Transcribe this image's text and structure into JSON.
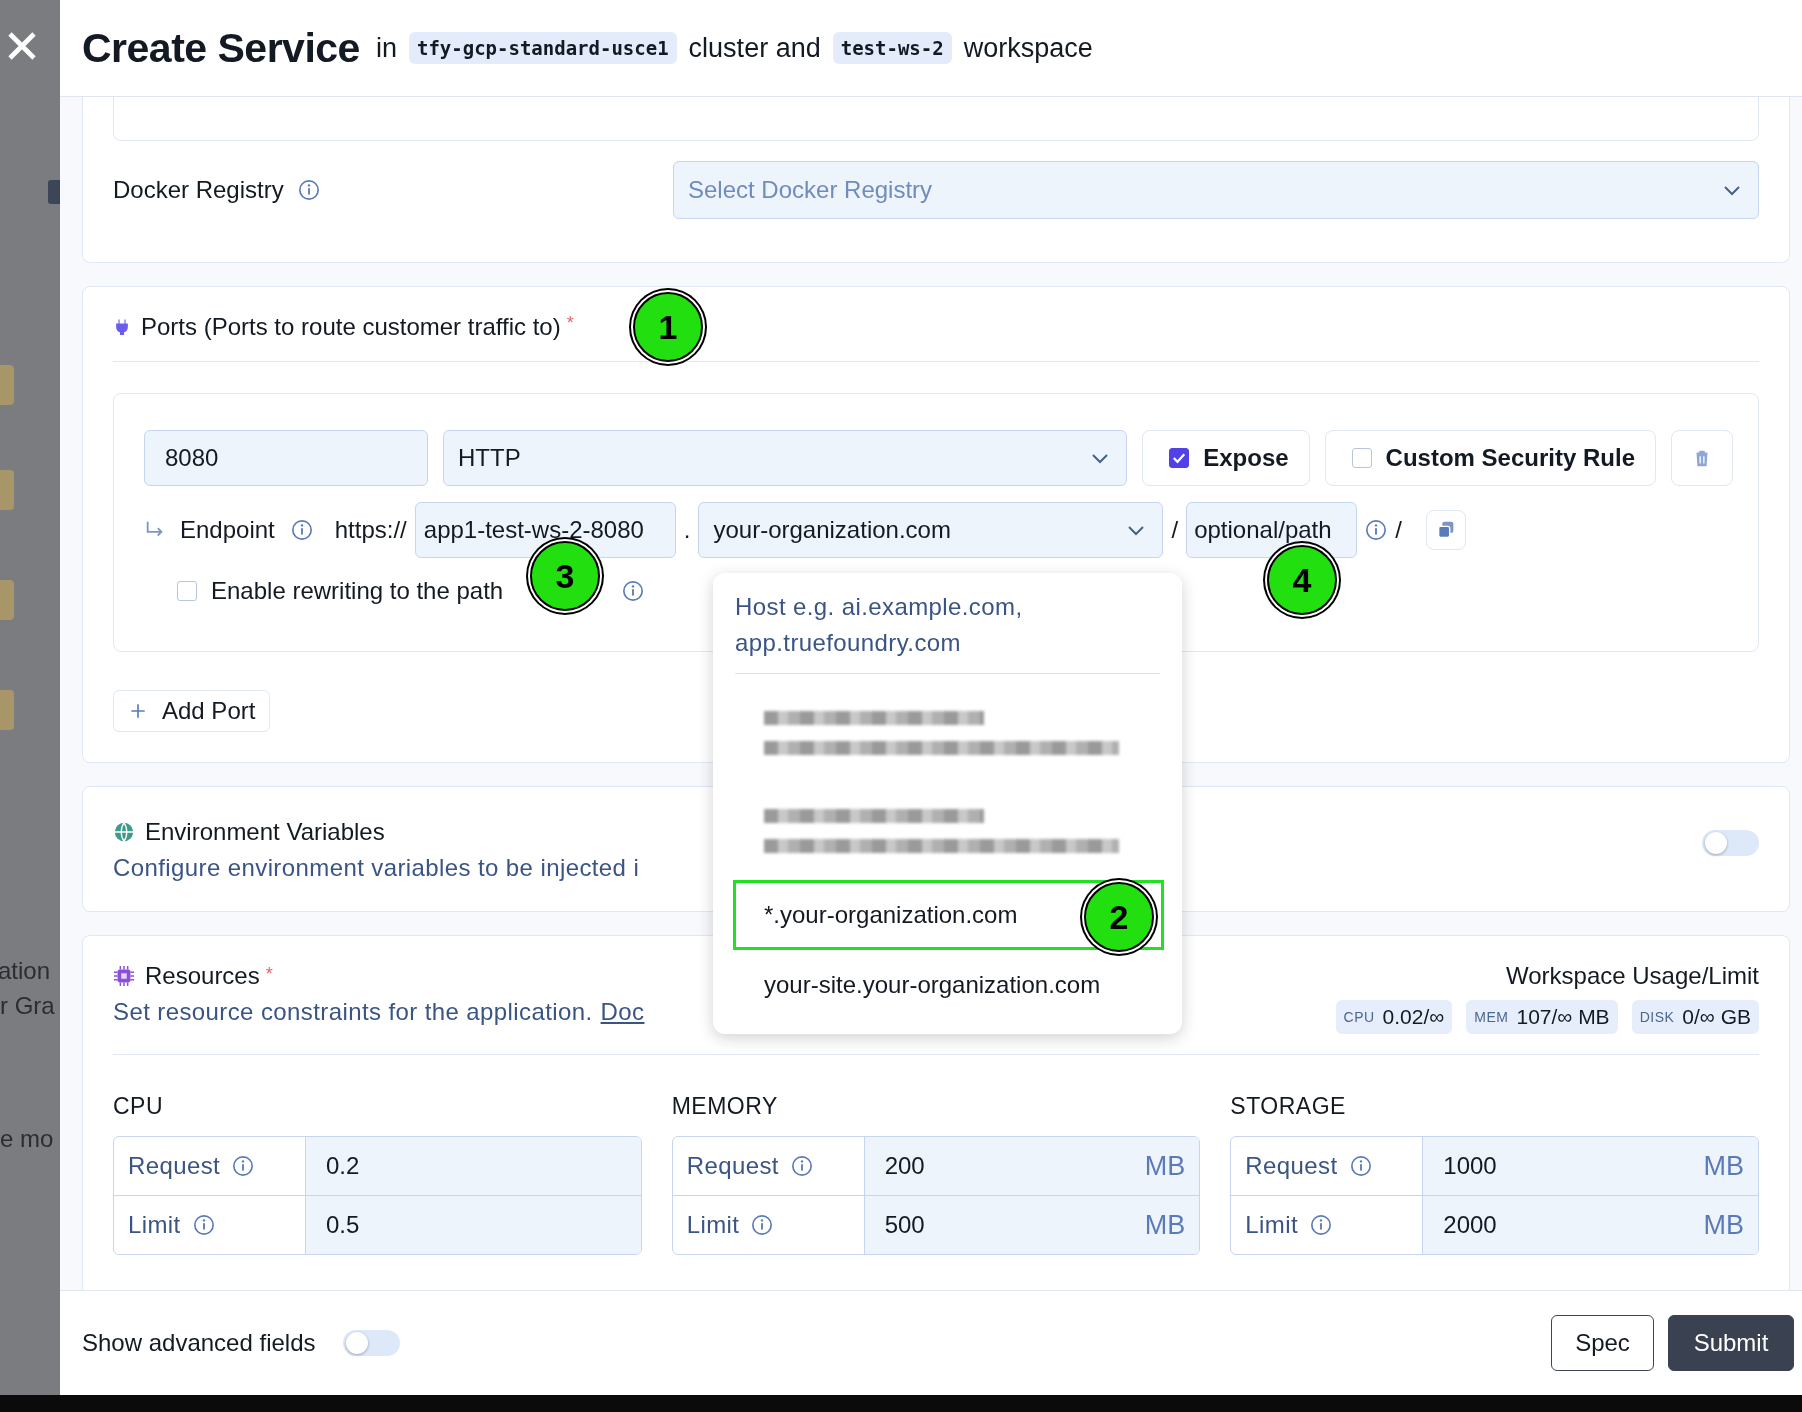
{
  "backdrop": {
    "texts": [
      {
        "text": "ation"
      },
      {
        "text": "r Gra"
      },
      {
        "text": "e mo"
      }
    ]
  },
  "header": {
    "title": "Create Service",
    "segments": [
      {
        "kind": "text",
        "text": "in"
      },
      {
        "kind": "tag",
        "text": "tfy-gcp-standard-usce1"
      },
      {
        "kind": "text",
        "text": "cluster and"
      },
      {
        "kind": "tag",
        "text": "test-ws-2"
      },
      {
        "kind": "text",
        "text": "workspace"
      }
    ]
  },
  "docker_registry": {
    "label": "Docker Registry",
    "placeholder": "Select Docker Registry"
  },
  "ports": {
    "title": "Ports (Ports to route customer traffic to)",
    "required_mark": "*",
    "items": [
      {
        "port": "8080",
        "protocol": "HTTP",
        "expose": {
          "label": "Expose",
          "checked": true
        },
        "custom_security_rule": {
          "label": "Custom Security Rule",
          "checked": false
        },
        "endpoint": {
          "label": "Endpoint",
          "scheme": "https://",
          "subdomain": "app1-test-ws-2-8080",
          "dot": ".",
          "host": "your-organization.com",
          "slash": "/",
          "path": "optional/path",
          "trailing_slash": "/"
        },
        "rewrite": {
          "label": "Enable rewriting to the path",
          "checked": false
        }
      }
    ],
    "add_button": "Add Port"
  },
  "host_dropdown": {
    "hint": "Host e.g. ai.example.com, app.truefoundry.com",
    "options": [
      {
        "kind": "redacted",
        "highlighted": false
      },
      {
        "kind": "redacted",
        "highlighted": false
      },
      {
        "kind": "text",
        "text": "*.your-organization.com",
        "highlighted": true
      },
      {
        "kind": "text",
        "text": "your-site.your-organization.com",
        "highlighted": false
      }
    ]
  },
  "environment_variables": {
    "title": "Environment Variables",
    "description": "Configure environment variables to be injected i",
    "on": false
  },
  "resources": {
    "title": "Resources",
    "required_mark": "*",
    "description": "Set resource constraints for the application.",
    "link": "Doc",
    "usage_title": "Workspace Usage/Limit",
    "usage": [
      {
        "label": "CPU",
        "value": "0.02/∞"
      },
      {
        "label": "MEM",
        "value": "107/∞ MB"
      },
      {
        "label": "DISK",
        "value": "0/∞ GB"
      }
    ],
    "groups": [
      {
        "title": "CPU",
        "rows": [
          {
            "label": "Request",
            "value": "0.2"
          },
          {
            "label": "Limit",
            "value": "0.5"
          }
        ]
      },
      {
        "title": "MEMORY",
        "rows": [
          {
            "label": "Request",
            "value": "200",
            "unit": "MB"
          },
          {
            "label": "Limit",
            "value": "500",
            "unit": "MB"
          }
        ]
      },
      {
        "title": "STORAGE",
        "rows": [
          {
            "label": "Request",
            "value": "1000",
            "unit": "MB"
          },
          {
            "label": "Limit",
            "value": "2000",
            "unit": "MB"
          }
        ]
      }
    ]
  },
  "annotations": [
    {
      "text": "1"
    },
    {
      "text": "2"
    },
    {
      "text": "3"
    },
    {
      "text": "4"
    }
  ],
  "footer": {
    "advanced_label": "Show advanced fields",
    "advanced_on": false,
    "buttons": [
      {
        "label": "Spec",
        "kind": "secondary"
      },
      {
        "label": "Submit",
        "kind": "primary"
      }
    ]
  }
}
